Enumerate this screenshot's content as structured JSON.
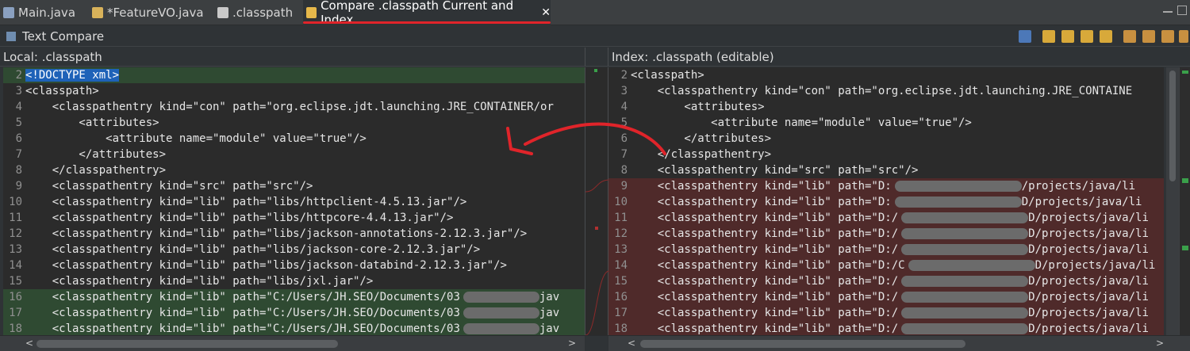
{
  "tabs": [
    {
      "label": "Main.java",
      "icon": "java-file-icon"
    },
    {
      "label": "*FeatureVO.java",
      "icon": "java-file-icon"
    },
    {
      "label": ".classpath",
      "icon": "xml-file-icon"
    },
    {
      "label": "Compare .classpath Current and Index",
      "icon": "compare-icon",
      "close": "✕"
    }
  ],
  "toolbar": {
    "title": "Text Compare"
  },
  "left": {
    "header": "Local: .classpath",
    "lines": [
      {
        "num": "2",
        "text": "<!DOCTYPE xml>"
      },
      {
        "num": "3",
        "text": "<classpath>"
      },
      {
        "num": "4",
        "text": "    <classpathentry kind=\"con\" path=\"org.eclipse.jdt.launching.JRE_CONTAINER/or"
      },
      {
        "num": "5",
        "text": "        <attributes>"
      },
      {
        "num": "6",
        "text": "            <attribute name=\"module\" value=\"true\"/>"
      },
      {
        "num": "7",
        "text": "        </attributes>"
      },
      {
        "num": "8",
        "text": "    </classpathentry>"
      },
      {
        "num": "9",
        "text": "    <classpathentry kind=\"src\" path=\"src\"/>"
      },
      {
        "num": "10",
        "text": "    <classpathentry kind=\"lib\" path=\"libs/httpclient-4.5.13.jar\"/>"
      },
      {
        "num": "11",
        "text": "    <classpathentry kind=\"lib\" path=\"libs/httpcore-4.4.13.jar\"/>"
      },
      {
        "num": "12",
        "text": "    <classpathentry kind=\"lib\" path=\"libs/jackson-annotations-2.12.3.jar\"/>"
      },
      {
        "num": "13",
        "text": "    <classpathentry kind=\"lib\" path=\"libs/jackson-core-2.12.3.jar\"/>"
      },
      {
        "num": "14",
        "text": "    <classpathentry kind=\"lib\" path=\"libs/jackson-databind-2.12.3.jar\"/>"
      },
      {
        "num": "15",
        "text": "    <classpathentry kind=\"lib\" path=\"libs/jxl.jar\"/>"
      },
      {
        "num": "16",
        "text": "    <classpathentry kind=\"lib\" path=\"C:/Users/JH.SEO/Documents/03",
        "tail": "jav"
      },
      {
        "num": "17",
        "text": "    <classpathentry kind=\"lib\" path=\"C:/Users/JH.SEO/Documents/03",
        "tail": "jav"
      },
      {
        "num": "18",
        "text": "    <classpathentry kind=\"lib\" path=\"C:/Users/JH.SEO/Documents/03",
        "tail": "jav"
      }
    ]
  },
  "right": {
    "header": "Index: .classpath (editable)",
    "lines": [
      {
        "num": "2",
        "text": "<classpath>"
      },
      {
        "num": "3",
        "text": "    <classpathentry kind=\"con\" path=\"org.eclipse.jdt.launching.JRE_CONTAINE"
      },
      {
        "num": "4",
        "text": "        <attributes>"
      },
      {
        "num": "5",
        "text": "            <attribute name=\"module\" value=\"true\"/>"
      },
      {
        "num": "6",
        "text": "        </attributes>"
      },
      {
        "num": "7",
        "text": "    </classpathentry>"
      },
      {
        "num": "8",
        "text": "    <classpathentry kind=\"src\" path=\"src\"/>"
      },
      {
        "num": "9",
        "text": "    <classpathentry kind=\"lib\" path=\"D:",
        "tail": "/projects/java/li"
      },
      {
        "num": "10",
        "text": "    <classpathentry kind=\"lib\" path=\"D:",
        "tail": "D/projects/java/li"
      },
      {
        "num": "11",
        "text": "    <classpathentry kind=\"lib\" path=\"D:/",
        "tail": "D/projects/java/li"
      },
      {
        "num": "12",
        "text": "    <classpathentry kind=\"lib\" path=\"D:/",
        "tail": "D/projects/java/li"
      },
      {
        "num": "13",
        "text": "    <classpathentry kind=\"lib\" path=\"D:/",
        "tail": "D/projects/java/li"
      },
      {
        "num": "14",
        "text": "    <classpathentry kind=\"lib\" path=\"D:/C",
        "tail": "D/projects/java/li"
      },
      {
        "num": "15",
        "text": "    <classpathentry kind=\"lib\" path=\"D:/",
        "tail": "D/projects/java/li"
      },
      {
        "num": "16",
        "text": "    <classpathentry kind=\"lib\" path=\"D:/",
        "tail": "D/projects/java/li"
      },
      {
        "num": "17",
        "text": "    <classpathentry kind=\"lib\" path=\"D:/",
        "tail": "D/projects/java/li"
      },
      {
        "num": "18",
        "text": "    <classpathentry kind=\"lib\" path=\"D:/",
        "tail": "D/projects/java/li"
      }
    ]
  },
  "scroll": {
    "left_arrow": "<",
    "right_arrow": ">"
  },
  "colors": {
    "annotation_arrow": "#e0242a",
    "added_bg": "#2f4a32",
    "changed_bg": "#4f2a2a",
    "selection": "#1e62b8"
  }
}
